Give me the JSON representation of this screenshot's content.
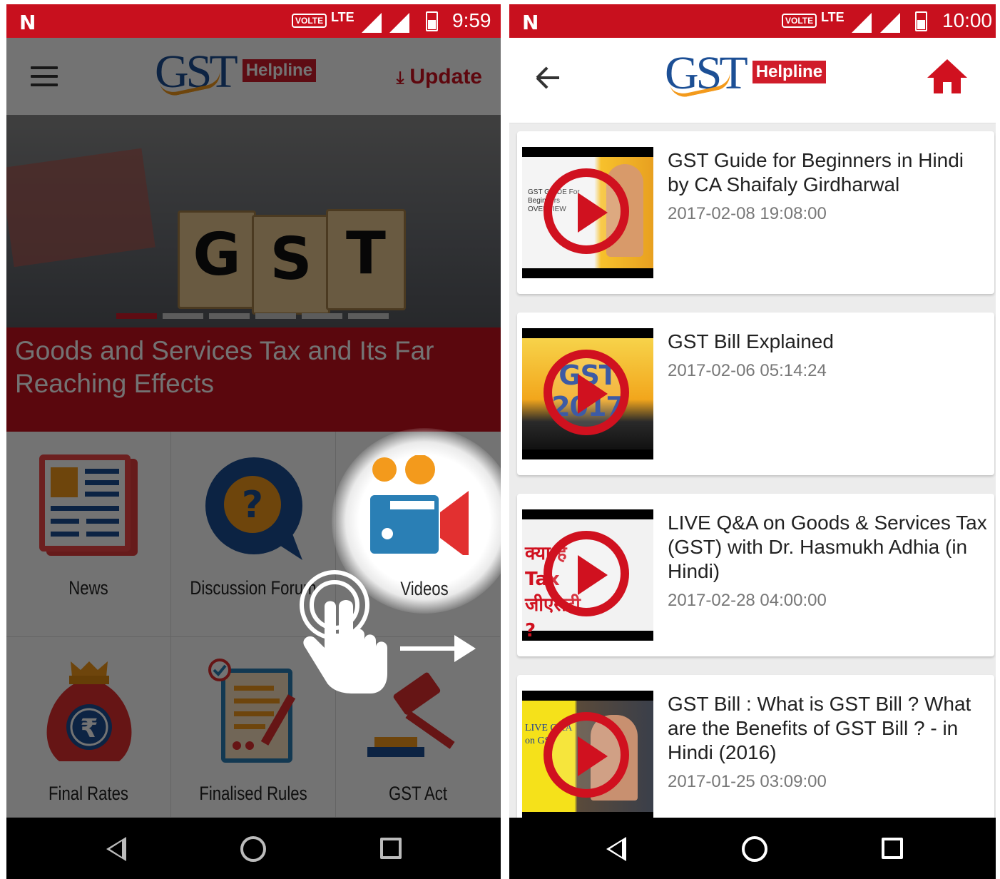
{
  "left_screen": {
    "status": {
      "network": "LTE",
      "volte": "VOLTE",
      "time": "9:59",
      "n_logo": "N"
    },
    "header": {
      "logo_text": "GST",
      "logo_badge": "Helpline",
      "update_label": "Update"
    },
    "banner": {
      "blocks": [
        "G",
        "S",
        "T"
      ],
      "caption": "Goods and Services Tax and Its Far Reaching Effects",
      "slide_count": 6,
      "active_slide": 1
    },
    "grid": {
      "items": [
        {
          "label": "News",
          "icon": "newspaper-icon"
        },
        {
          "label": "Discussion Forum",
          "icon": "question-bubble-icon"
        },
        {
          "label": "Videos",
          "icon": "video-camera-icon"
        },
        {
          "label": "Final Rates",
          "icon": "money-bag-icon"
        },
        {
          "label": "Finalised Rules",
          "icon": "document-pen-icon"
        },
        {
          "label": "GST Act",
          "icon": "gavel-icon"
        }
      ]
    },
    "overlay": {
      "gesture": "tap-hand-icon",
      "arrow": "right-arrow-icon"
    }
  },
  "right_screen": {
    "status": {
      "network": "LTE",
      "volte": "VOLTE",
      "time": "10:00",
      "n_logo": "N"
    },
    "header": {
      "logo_text": "GST",
      "logo_badge": "Helpline"
    },
    "videos": [
      {
        "title": "GST Guide for Beginners in Hindi by CA Shaifaly Girdharwal",
        "date": "2017-02-08 19:08:00",
        "thumb_text": "GST GUIDE For Beginners OVERVIEW"
      },
      {
        "title": "GST Bill Explained",
        "date": "2017-02-06 05:14:24",
        "thumb_text": "GST 2017"
      },
      {
        "title": "LIVE Q&A on Goods & Services Tax (GST) with Dr. Hasmukh Adhia (in Hindi)",
        "date": "2017-02-28 04:00:00",
        "thumb_text": "क्या है Tax जीएसटी ?"
      },
      {
        "title": "GST Bill : What is GST Bill ? What are the Benefits of GST Bill ? - in Hindi (2016)",
        "date": "2017-01-25 03:09:00",
        "thumb_text": "LIVE Q&A on GST"
      }
    ]
  },
  "colors": {
    "brand_red": "#c8101e",
    "brand_blue": "#1c4f95",
    "brand_orange": "#f39a1c"
  }
}
